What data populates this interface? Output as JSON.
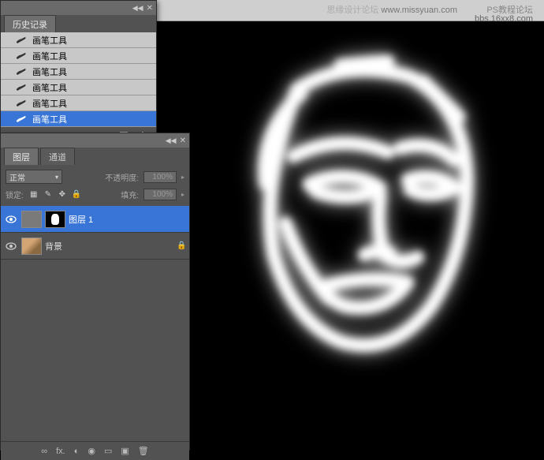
{
  "watermark": {
    "site": "PS教程论坛",
    "forum": "思缘设计论坛",
    "url": "bbs.16xx8.com",
    "extra": "www.missyuan.com"
  },
  "history": {
    "tab": "历史记录",
    "items": [
      {
        "label": "画笔工具"
      },
      {
        "label": "画笔工具"
      },
      {
        "label": "画笔工具"
      },
      {
        "label": "画笔工具"
      },
      {
        "label": "画笔工具"
      },
      {
        "label": "画笔工具",
        "selected": true
      }
    ]
  },
  "layers": {
    "tabs": [
      "图层",
      "通道"
    ],
    "blend_mode": "正常",
    "opacity_label": "不透明度:",
    "opacity_value": "100%",
    "fill_label": "填充:",
    "fill_value": "100%",
    "lock_label": "锁定:",
    "items": [
      {
        "name": "图层 1",
        "selected": true,
        "has_mask": true
      },
      {
        "name": "背景",
        "locked": true
      }
    ],
    "footer_icons": [
      "∞",
      "fx.",
      "◐",
      "◉",
      "▭",
      "▣",
      "🗑"
    ]
  }
}
